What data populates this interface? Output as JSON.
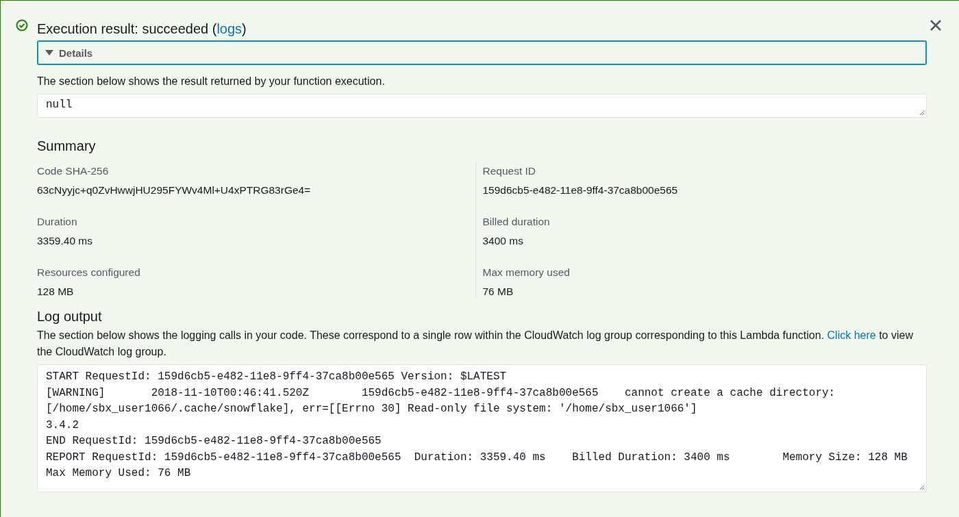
{
  "result": {
    "succeeded": true,
    "title_prefix": "Execution result: succeeded (",
    "link": "logs",
    "title_suffix": ")"
  },
  "details": {
    "label": "Details",
    "expanded": true
  },
  "result_section": {
    "description": "The section below shows the result returned by your function execution.",
    "value": "null"
  },
  "summary": {
    "title": "Summary",
    "fields": [
      {
        "label": "Code SHA-256",
        "value": "63cNyyjc+q0ZvHwwjHU295FYWv4Ml+U4xPTRG83rGe4="
      },
      {
        "label": "Request ID",
        "value": "159d6cb5-e482-11e8-9ff4-37ca8b00e565"
      },
      {
        "label": "Duration",
        "value": "3359.40 ms"
      },
      {
        "label": "Billed duration",
        "value": "3400 ms"
      },
      {
        "label": "Resources configured",
        "value": "128 MB"
      },
      {
        "label": "Max memory used",
        "value": "76 MB"
      }
    ]
  },
  "log_output": {
    "title": "Log output",
    "description_before": "The section below shows the logging calls in your code. These correspond to a single row within the CloudWatch log group corresponding to this Lambda function.",
    "link": "Click here",
    "description_after": "to view the CloudWatch log group.",
    "lines": [
      "START RequestId: 159d6cb5-e482-11e8-9ff4-37ca8b00e565 Version: $LATEST",
      "[WARNING]       2018-11-10T00:46:41.520Z        159d6cb5-e482-11e8-9ff4-37ca8b00e565    cannot create a cache directory:",
      "[/home/sbx_user1066/.cache/snowflake], err=[[Errno 30] Read-only file system: '/home/sbx_user1066']",
      "3.4.2",
      "END RequestId: 159d6cb5-e482-11e8-9ff4-37ca8b00e565",
      "REPORT RequestId: 159d6cb5-e482-11e8-9ff4-37ca8b00e565  Duration: 3359.40 ms    Billed Duration: 3400 ms        Memory Size: 128 MB",
      "Max Memory Used: 76 MB"
    ]
  }
}
